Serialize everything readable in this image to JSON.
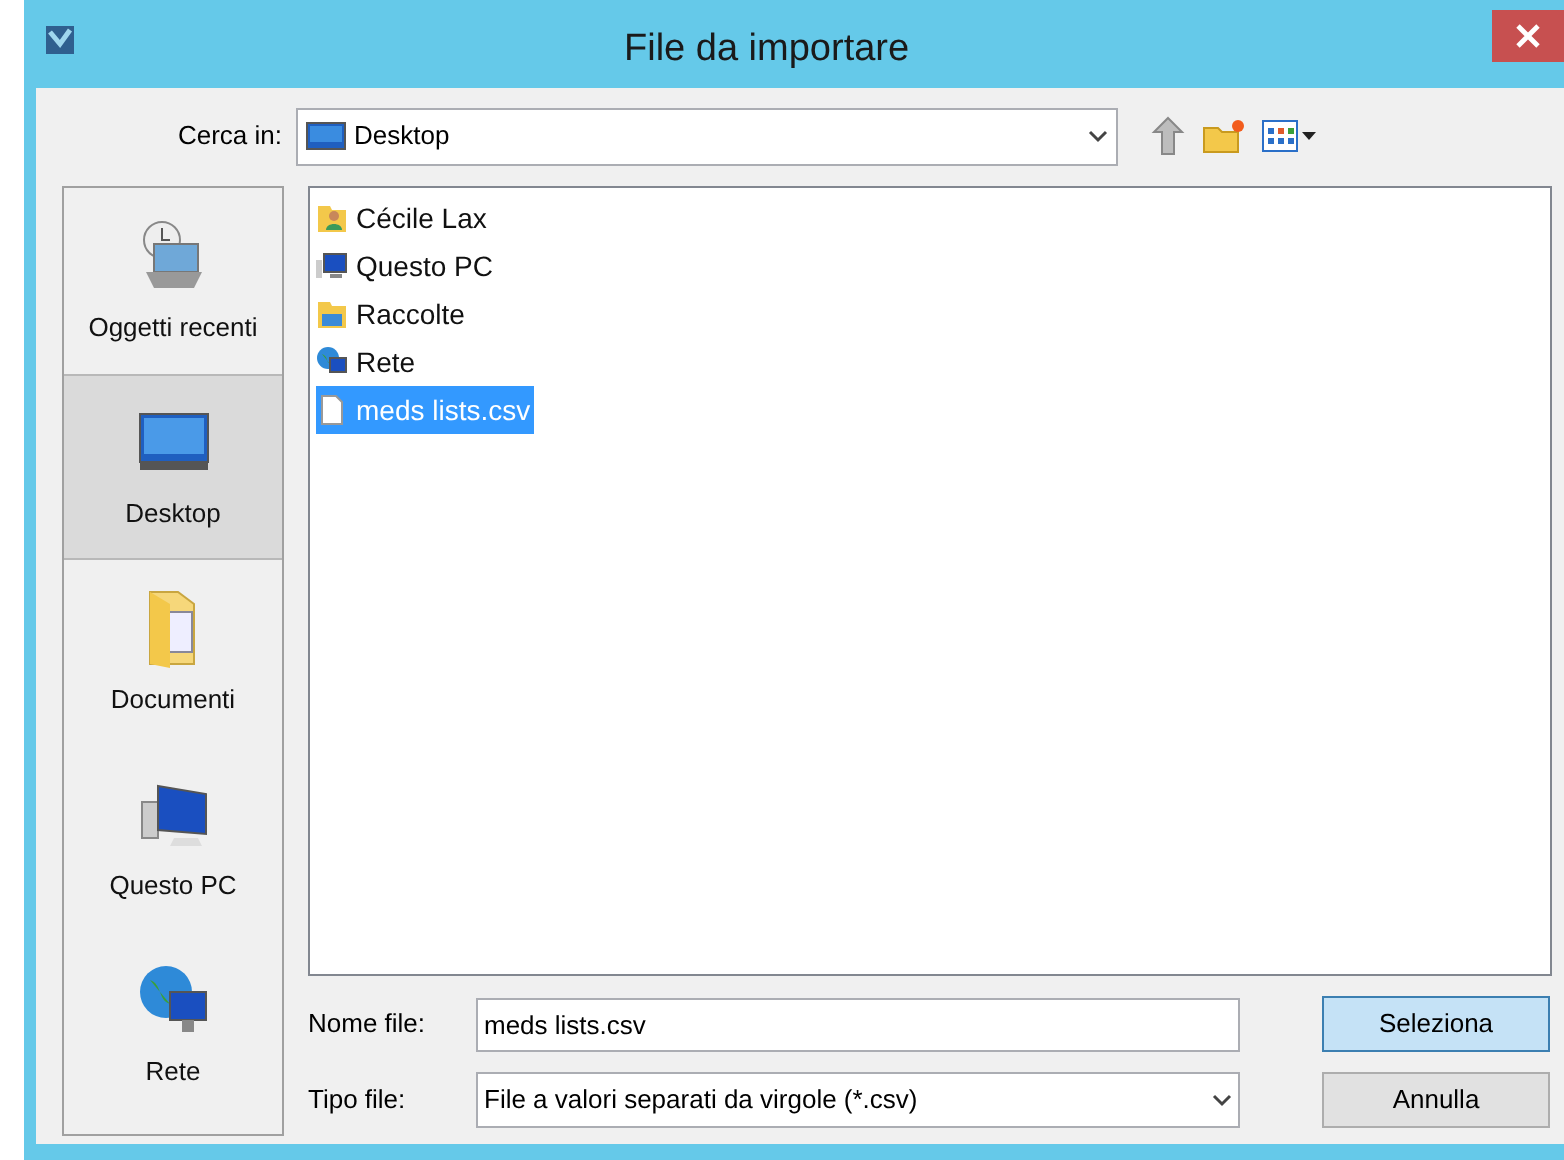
{
  "window": {
    "title": "File da importare"
  },
  "look_in": {
    "label": "Cerca in:",
    "value": "Desktop"
  },
  "sidebar": {
    "items": [
      {
        "label": "Oggetti recenti",
        "kind": "recent",
        "selected": false
      },
      {
        "label": "Desktop",
        "kind": "desktop",
        "selected": true
      },
      {
        "label": "Documenti",
        "kind": "documents",
        "selected": false
      },
      {
        "label": "Questo PC",
        "kind": "pc",
        "selected": false
      },
      {
        "label": "Rete",
        "kind": "network",
        "selected": false
      }
    ]
  },
  "files": [
    {
      "name": "Cécile Lax",
      "kind": "user",
      "selected": false
    },
    {
      "name": "Questo PC",
      "kind": "pc",
      "selected": false
    },
    {
      "name": "Raccolte",
      "kind": "library",
      "selected": false
    },
    {
      "name": "Rete",
      "kind": "network",
      "selected": false
    },
    {
      "name": "meds lists.csv",
      "kind": "file",
      "selected": true
    }
  ],
  "file_name": {
    "label": "Nome file:",
    "value": "meds lists.csv"
  },
  "file_type": {
    "label": "Tipo file:",
    "value": "File a valori separati da virgole (*.csv)"
  },
  "buttons": [
    {
      "label": "Seleziona",
      "kind": "default"
    },
    {
      "label": "Annulla",
      "kind": "normal"
    }
  ]
}
